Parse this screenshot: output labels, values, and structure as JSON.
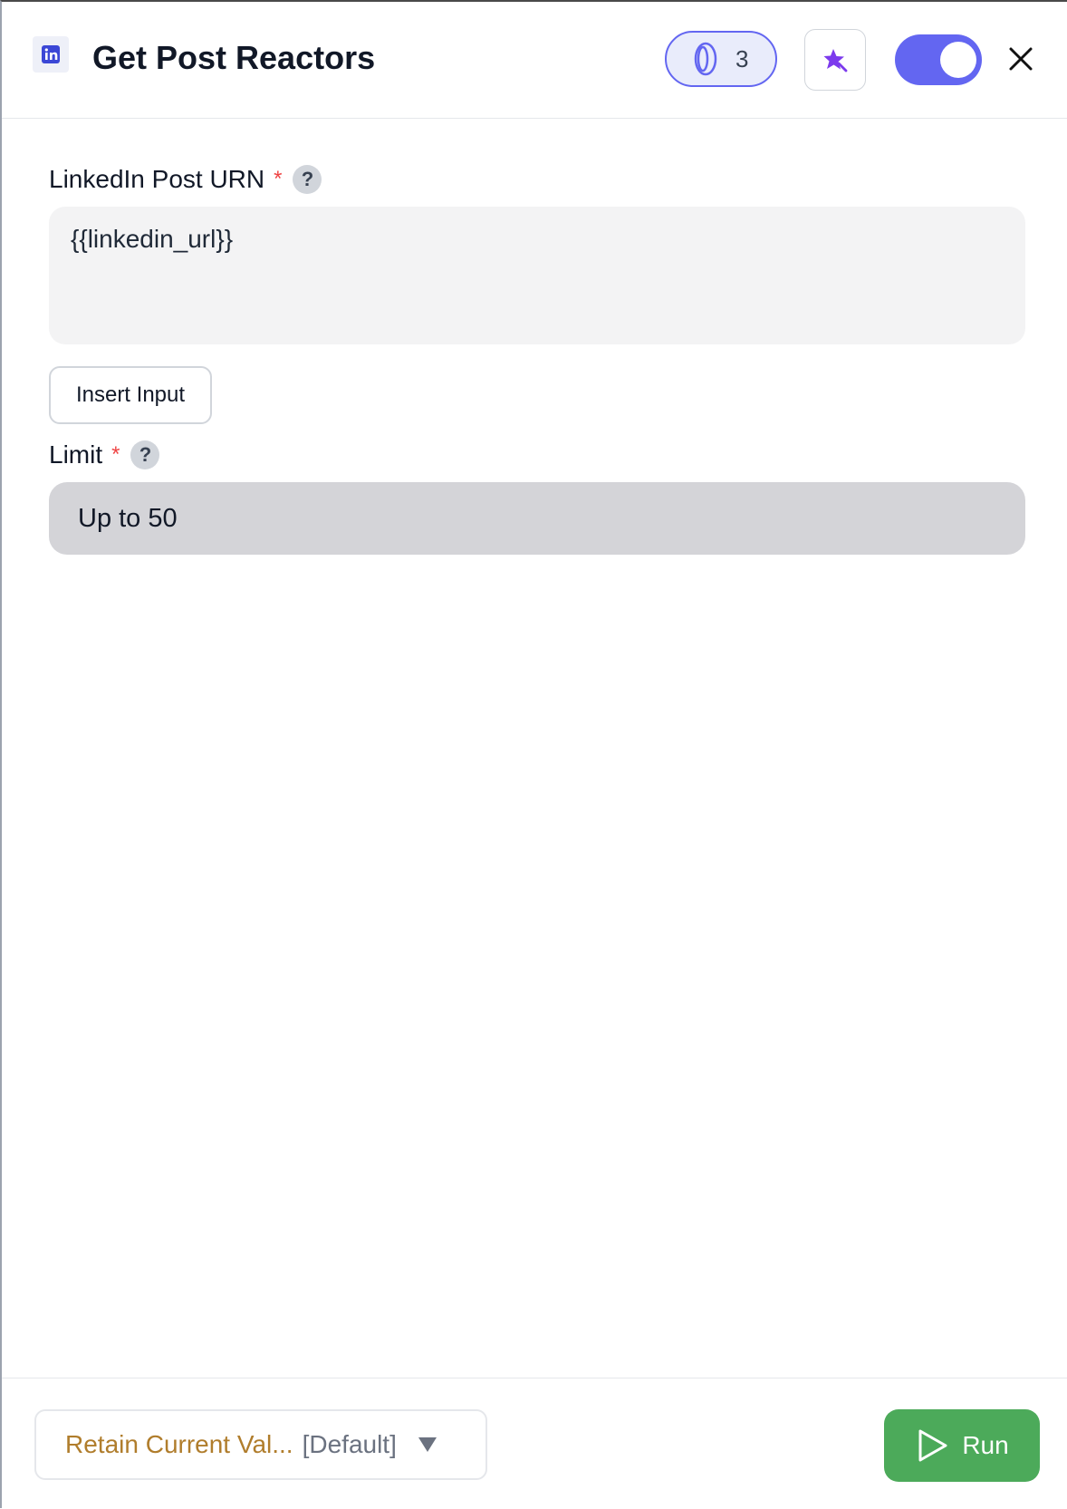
{
  "header": {
    "app_icon": "linkedin-icon",
    "title": "Get Post Reactors",
    "credits": {
      "icon": "coin-icon",
      "count": "3"
    },
    "magic_icon": "sparkle-star-icon",
    "toggle_on": true,
    "close_icon": "close-icon"
  },
  "fields": {
    "urn": {
      "label": "LinkedIn Post URN",
      "required_mark": "*",
      "help": "?",
      "value": "{{linkedin_url}}"
    },
    "insert_input_label": "Insert Input",
    "limit": {
      "label": "Limit",
      "required_mark": "*",
      "help": "?",
      "value": "Up to 50"
    }
  },
  "footer": {
    "retain_value": "Retain Current Val...",
    "retain_default": "[Default]",
    "run_label": "Run",
    "run_icon": "play-icon"
  },
  "colors": {
    "accent": "#6366f1",
    "run_green": "#4caa5a",
    "retain_text": "#b07d2c",
    "required": "#ef4444"
  }
}
